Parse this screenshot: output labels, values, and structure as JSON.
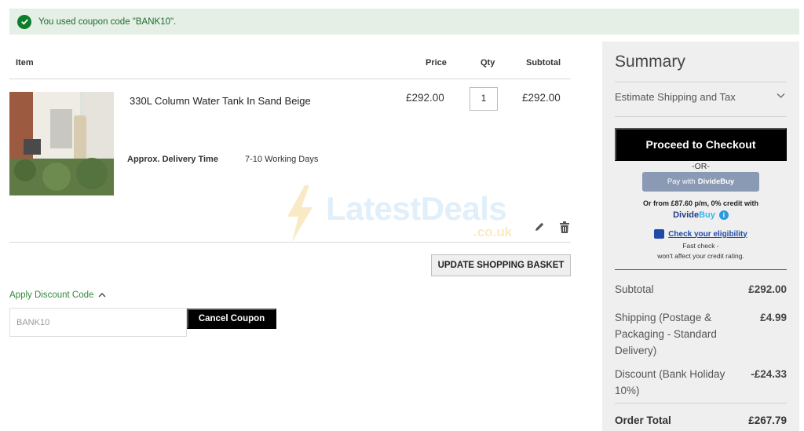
{
  "notice": {
    "message": "You used coupon code \"BANK10\"."
  },
  "table": {
    "headers": {
      "item": "Item",
      "price": "Price",
      "qty": "Qty",
      "subtotal": "Subtotal"
    }
  },
  "product": {
    "name": "330L Column Water Tank In Sand Beige",
    "price": "£292.00",
    "qty": "1",
    "subtotal": "£292.00",
    "delivery_label": "Approx. Delivery Time",
    "delivery_value": "7-10 Working Days"
  },
  "watermark": {
    "text": "LatestDeals",
    "sub": ".co.uk"
  },
  "actions": {
    "update_label": "UPDATE SHOPPING BASKET"
  },
  "discount": {
    "toggle_label": "Apply Discount Code",
    "code_value": "BANK10",
    "cancel_label": "Cancel Coupon"
  },
  "summary": {
    "title": "Summary",
    "estimate_label": "Estimate Shipping and Tax",
    "checkout_label": "Proceed to Checkout",
    "or_label": "-OR-",
    "pay_with_label": "Pay with",
    "pay_with_brand": "DivideBuy",
    "finance_text": "Or from £87.60 p/m, 0% credit with",
    "dividebuy_logo_a": "Divide",
    "dividebuy_logo_b": "Buy",
    "eligibility_link": "Check your eligibility",
    "fast_check": "Fast check -",
    "no_affect": "won't affect your credit rating.",
    "rows": [
      {
        "label": "Subtotal",
        "value": "£292.00"
      },
      {
        "label": "Shipping (Postage & Packaging - Standard Delivery)",
        "value": "£4.99"
      },
      {
        "label": "Discount (Bank Holiday 10%)",
        "value": "-£24.33"
      }
    ],
    "total": {
      "label": "Order Total",
      "value": "£267.79"
    }
  },
  "colors": {
    "success_bg": "#e5efe5",
    "success_icon": "#0c7d2a",
    "link_green": "#2f8a3a",
    "checkout_bg": "#000000",
    "dividebuy_button": "#8a9ab4",
    "dividebuy_blue": "#1f4aa8"
  },
  "icons": [
    "check-circle-icon",
    "chevron-down-icon",
    "chevron-up-icon",
    "pencil-icon",
    "trash-icon",
    "info-icon",
    "lightning-bolt-icon"
  ]
}
